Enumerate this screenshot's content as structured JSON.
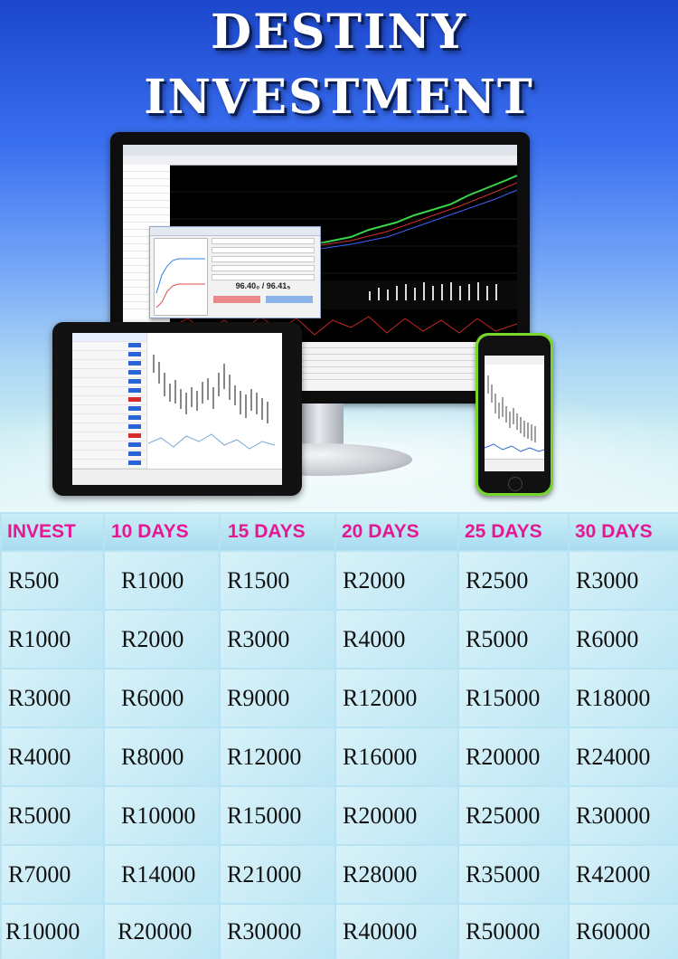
{
  "header": {
    "title_line1": "DESTINY",
    "title_line2": "INVESTMENT"
  },
  "hero_image": {
    "monitor_dialog_price": "96.40₀ / 96.41₅",
    "devices": [
      "desktop-monitor",
      "tablet",
      "smartphone"
    ]
  },
  "table": {
    "headers": [
      "INVEST",
      "10 DAYS",
      "15 DAYS",
      "20 DAYS",
      "25 DAYS",
      "30 DAYS"
    ],
    "rows": [
      [
        "R500",
        "R1000",
        "R1500",
        "R2000",
        "R2500",
        "R3000"
      ],
      [
        "R1000",
        "R2000",
        "R3000",
        "R4000",
        "R5000",
        "R6000"
      ],
      [
        "R3000",
        "R6000",
        "R9000",
        "R12000",
        "R15000",
        "R18000"
      ],
      [
        "R4000",
        "R8000",
        "R12000",
        "R16000",
        "R20000",
        "R24000"
      ],
      [
        "R5000",
        "R10000",
        "R15000",
        "R20000",
        "R25000",
        "R30000"
      ],
      [
        "R7000",
        "R14000",
        "R21000",
        "R28000",
        "R35000",
        "R42000"
      ],
      [
        "R10000",
        "R20000",
        "R30000",
        "R40000",
        "R50000",
        "R60000"
      ]
    ]
  },
  "colors": {
    "header_text": "#e71793",
    "title_text": "#ffffff",
    "sky_top": "#1c47cc",
    "table_bg": "#c8ebf6"
  }
}
